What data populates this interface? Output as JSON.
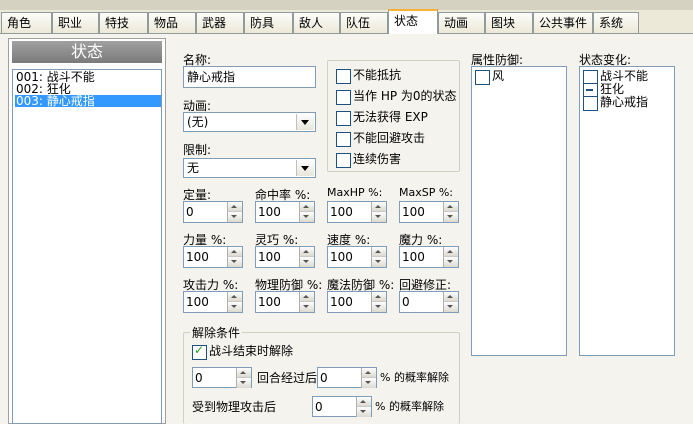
{
  "tabs": [
    {
      "label": "角色"
    },
    {
      "label": "职业"
    },
    {
      "label": "特技"
    },
    {
      "label": "物品"
    },
    {
      "label": "武器"
    },
    {
      "label": "防具"
    },
    {
      "label": "敌人"
    },
    {
      "label": "队伍"
    },
    {
      "label": "状态"
    },
    {
      "label": "动画"
    },
    {
      "label": "图块"
    },
    {
      "label": "公共事件"
    },
    {
      "label": "系统"
    }
  ],
  "list": {
    "header": "状态",
    "items": [
      {
        "label": "001: 战斗不能"
      },
      {
        "label": "002: 狂化"
      },
      {
        "label": "003: 静心戒指"
      }
    ]
  },
  "form": {
    "name_label": "名称:",
    "name_value": "静心戒指",
    "animation_label": "动画:",
    "animation_value": "(无)",
    "restriction_label": "限制:",
    "restriction_value": "无",
    "stats": [
      {
        "label": "定量:",
        "value": "0"
      },
      {
        "label": "命中率 %:",
        "value": "100"
      },
      {
        "label": "MaxHP %:",
        "value": "100"
      },
      {
        "label": "MaxSP %:",
        "value": "100"
      },
      {
        "label": "力量 %:",
        "value": "100"
      },
      {
        "label": "灵巧 %:",
        "value": "100"
      },
      {
        "label": "速度 %:",
        "value": "100"
      },
      {
        "label": "魔力 %:",
        "value": "100"
      },
      {
        "label": "攻击力 %:",
        "value": "100"
      },
      {
        "label": "物理防御 %:",
        "value": "100"
      },
      {
        "label": "魔法防御 %:",
        "value": "100"
      },
      {
        "label": "回避修正:",
        "value": "0"
      }
    ],
    "flags": [
      {
        "label": "不能抵抗",
        "checked": false
      },
      {
        "label": "当作 HP 为0的状态",
        "checked": false
      },
      {
        "label": "无法获得 EXP",
        "checked": false
      },
      {
        "label": "不能回避攻击",
        "checked": false
      },
      {
        "label": "连续伤害",
        "checked": false
      }
    ],
    "release": {
      "title": "解除条件",
      "battle_end_label": "战斗结束时解除",
      "battle_end_checked": true,
      "turns_value": "0",
      "turns_text": "回合经过后",
      "turns_pct_value": "0",
      "turns_pct_text": "% 的概率解除",
      "phys_text": "受到物理攻击后",
      "phys_pct_value": "0",
      "phys_pct_text": "% 的概率解除"
    }
  },
  "element_defense": {
    "label": "属性防御:",
    "items": [
      {
        "label": "风",
        "state": "none"
      }
    ]
  },
  "state_change": {
    "label": "状态变化:",
    "items": [
      {
        "label": "战斗不能",
        "state": "none"
      },
      {
        "label": "狂化",
        "state": "minus"
      },
      {
        "label": "静心戒指",
        "state": "none"
      }
    ]
  },
  "colors": {
    "tab_active_accent": "#f9b233",
    "selection": "#3399ff",
    "check": "#21a121"
  }
}
